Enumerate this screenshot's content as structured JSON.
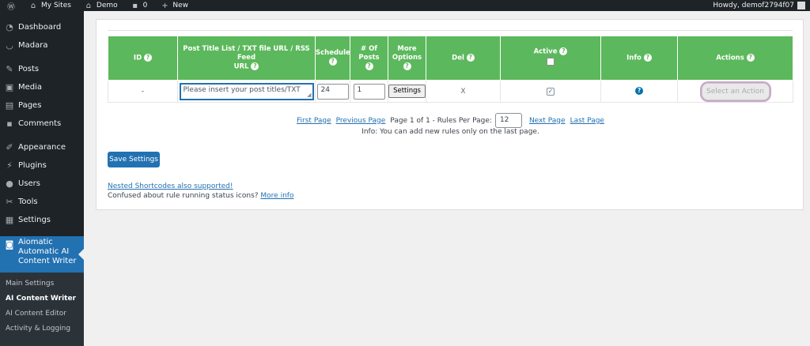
{
  "adminbar": {
    "items": [
      {
        "label": "",
        "icon": "wordpress-logo-icon"
      },
      {
        "label": "My Sites",
        "icon": "my-sites-icon"
      },
      {
        "label": "Demo",
        "icon": "home-icon"
      },
      {
        "label": "0",
        "icon": "comment-bubble-icon"
      },
      {
        "label": "New",
        "icon": "plus-icon"
      }
    ],
    "greeting": "Howdy, demof2794f07"
  },
  "sidebar": {
    "items": [
      {
        "label": "Dashboard",
        "icon": "dashboard-icon"
      },
      {
        "label": "Madara",
        "icon": "smile-icon"
      },
      {
        "label": "Posts",
        "icon": "pin-icon"
      },
      {
        "label": "Media",
        "icon": "media-icon"
      },
      {
        "label": "Pages",
        "icon": "pages-icon"
      },
      {
        "label": "Comments",
        "icon": "comments-icon"
      },
      {
        "label": "Appearance",
        "icon": "brush-icon"
      },
      {
        "label": "Plugins",
        "icon": "plugin-icon"
      },
      {
        "label": "Users",
        "icon": "user-icon"
      },
      {
        "label": "Tools",
        "icon": "wrench-icon"
      },
      {
        "label": "Settings",
        "icon": "settings-icon"
      }
    ],
    "active": {
      "line1": "Aiomatic",
      "line2": "Automatic AI",
      "line3": "Content Writer"
    },
    "submenu": [
      "Main Settings",
      "AI Content Writer",
      "AI Content Editor",
      "Activity & Logging"
    ]
  },
  "table": {
    "headers": {
      "id": "ID",
      "title_list_1": "Post Title List / TXT file URL / RSS Feed",
      "title_list_2": "URL",
      "schedule": "Schedule",
      "num_posts": "# Of Posts",
      "more_1": "More",
      "more_2": "Options",
      "del": "Del",
      "active": "Active",
      "info": "Info",
      "actions": "Actions"
    },
    "row": {
      "id": "-",
      "title_placeholder": "Please insert your post titles/TXT",
      "schedule": "24",
      "num_posts": "1",
      "settings_label": "Settings",
      "del": "X",
      "active_checked": true,
      "action_placeholder": "Select an Action"
    }
  },
  "pager": {
    "first": "First Page",
    "previous": "Previous Page",
    "status": "Page 1 of 1 - Rules Per Page:",
    "rules_per_page": "12",
    "next": "Next Page",
    "last": "Last Page"
  },
  "info_text": "Info: You can add new rules only on the last page.",
  "save_label": "Save Settings",
  "nested_link": "Nested Shortcodes also supported!",
  "confused_text": "Confused about rule running status icons?",
  "more_info_link": "More info",
  "help_glyph": "?",
  "check_glyph": "✓",
  "colors": {
    "header_green": "#5cb85c",
    "wp_blue": "#2271b1",
    "sidebar_dark": "#1d2327"
  }
}
